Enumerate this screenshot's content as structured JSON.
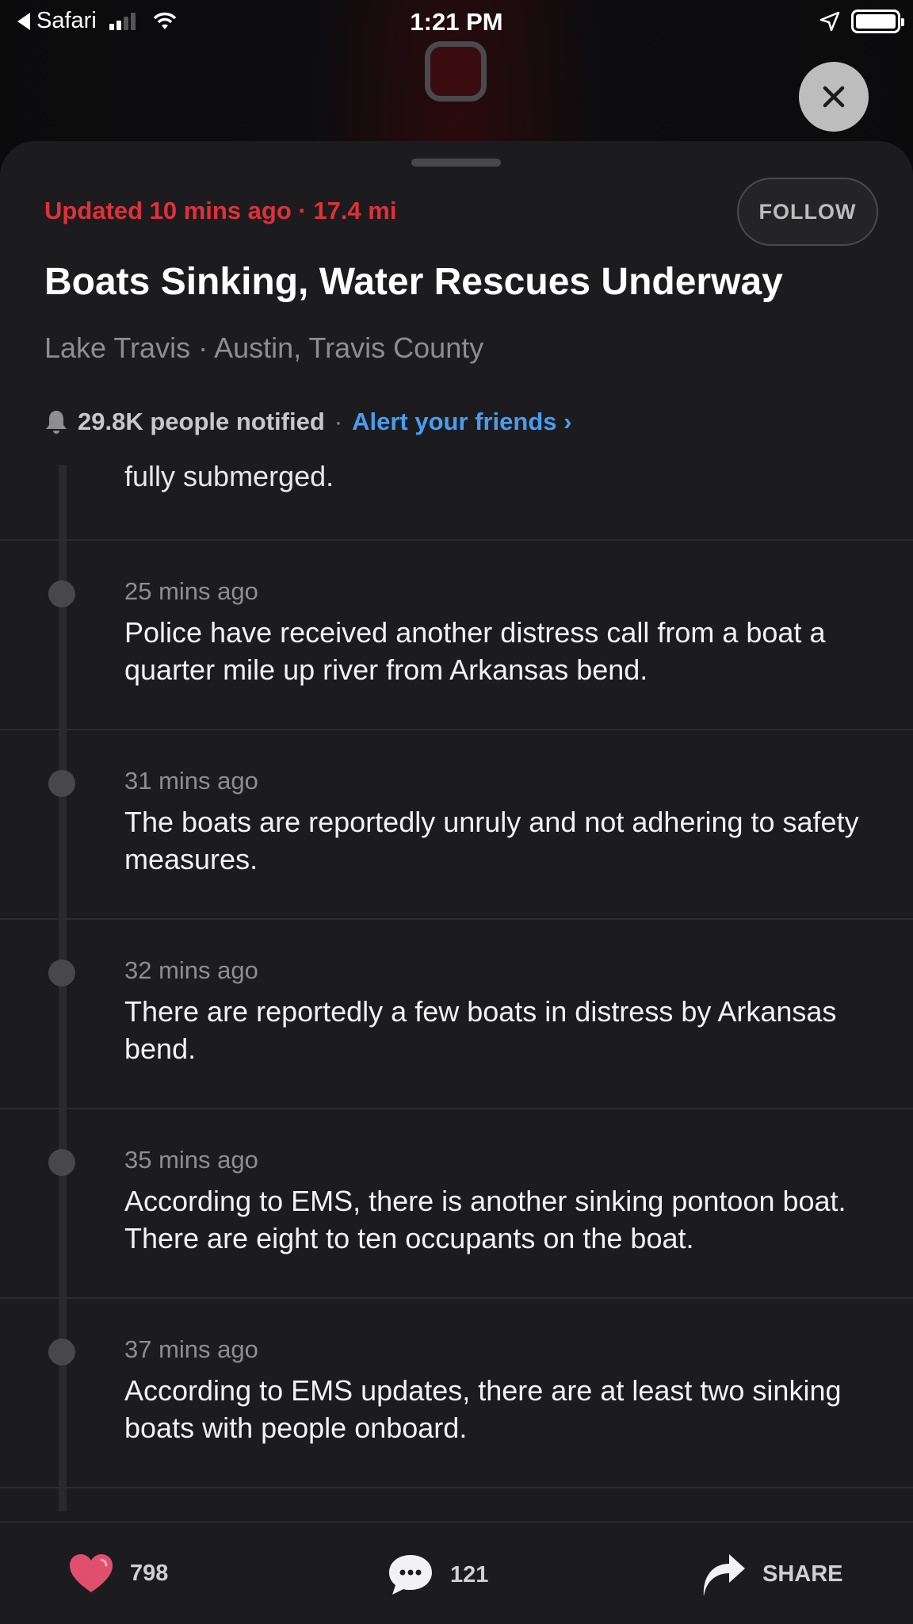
{
  "status_bar": {
    "back_app": "Safari",
    "time": "1:21 PM"
  },
  "incident": {
    "updated": "Updated 10 mins ago · 17.4 mi",
    "follow_label": "FOLLOW",
    "title": "Boats Sinking, Water Rescues Underway",
    "location": "Lake Travis · Austin, Travis County",
    "notified_count": "29.8K people notified",
    "separator": "·",
    "alert_link": "Alert your friends ›"
  },
  "timeline": {
    "partial_text": "fully submerged.",
    "entries": [
      {
        "time": "25 mins ago",
        "text": "Police have received another distress call from a boat a quarter mile up river from Arkansas bend."
      },
      {
        "time": "31 mins ago",
        "text": "The boats are reportedly unruly and not adhering to safety measures."
      },
      {
        "time": "32 mins ago",
        "text": "There are reportedly a few boats in distress by Arkansas bend."
      },
      {
        "time": "35 mins ago",
        "text": "According to EMS, there is another sinking pontoon boat. There are eight to ten occupants on the boat."
      },
      {
        "time": "37 mins ago",
        "text": "According to EMS updates, there are at least two sinking boats with people onboard."
      }
    ]
  },
  "bottom_bar": {
    "likes": "798",
    "comments": "121",
    "share_label": "SHARE"
  },
  "colors": {
    "alert_red": "#e0303a",
    "link_blue": "#4a9cf0",
    "heart_pink": "#e0506e",
    "sheet_bg": "#1c1c1e"
  },
  "icons": [
    "back-arrow-icon",
    "signal-icon",
    "wifi-icon",
    "location-arrow-icon",
    "battery-icon",
    "close-icon",
    "bell-icon",
    "heart-icon",
    "comment-icon",
    "share-arrow-icon"
  ]
}
